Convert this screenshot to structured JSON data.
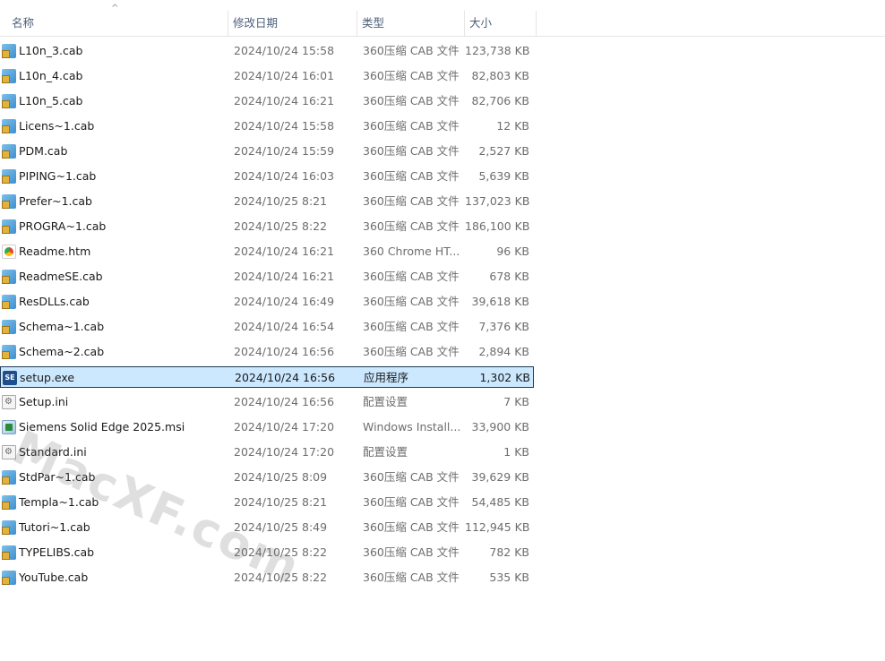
{
  "columns": {
    "name": "名称",
    "date": "修改日期",
    "type": "类型",
    "size": "大小"
  },
  "files": [
    {
      "name": "L10n_3.cab",
      "date": "2024/10/24 15:58",
      "type": "360压缩 CAB 文件",
      "size": "123,738 KB",
      "icon": "cab-archive-icon"
    },
    {
      "name": "L10n_4.cab",
      "date": "2024/10/24 16:01",
      "type": "360压缩 CAB 文件",
      "size": "82,803 KB",
      "icon": "cab-archive-icon"
    },
    {
      "name": "L10n_5.cab",
      "date": "2024/10/24 16:21",
      "type": "360压缩 CAB 文件",
      "size": "82,706 KB",
      "icon": "cab-archive-icon"
    },
    {
      "name": "Licens~1.cab",
      "date": "2024/10/24 15:58",
      "type": "360压缩 CAB 文件",
      "size": "12 KB",
      "icon": "cab-archive-icon"
    },
    {
      "name": "PDM.cab",
      "date": "2024/10/24 15:59",
      "type": "360压缩 CAB 文件",
      "size": "2,527 KB",
      "icon": "cab-archive-icon"
    },
    {
      "name": "PIPING~1.cab",
      "date": "2024/10/24 16:03",
      "type": "360压缩 CAB 文件",
      "size": "5,639 KB",
      "icon": "cab-archive-icon"
    },
    {
      "name": "Prefer~1.cab",
      "date": "2024/10/25 8:21",
      "type": "360压缩 CAB 文件",
      "size": "137,023 KB",
      "icon": "cab-archive-icon"
    },
    {
      "name": "PROGRA~1.cab",
      "date": "2024/10/25 8:22",
      "type": "360压缩 CAB 文件",
      "size": "186,100 KB",
      "icon": "cab-archive-icon"
    },
    {
      "name": "Readme.htm",
      "date": "2024/10/24 16:21",
      "type": "360 Chrome HT...",
      "size": "96 KB",
      "icon": "html-document-icon"
    },
    {
      "name": "ReadmeSE.cab",
      "date": "2024/10/24 16:21",
      "type": "360压缩 CAB 文件",
      "size": "678 KB",
      "icon": "cab-archive-icon"
    },
    {
      "name": "ResDLLs.cab",
      "date": "2024/10/24 16:49",
      "type": "360压缩 CAB 文件",
      "size": "39,618 KB",
      "icon": "cab-archive-icon"
    },
    {
      "name": "Schema~1.cab",
      "date": "2024/10/24 16:54",
      "type": "360压缩 CAB 文件",
      "size": "7,376 KB",
      "icon": "cab-archive-icon"
    },
    {
      "name": "Schema~2.cab",
      "date": "2024/10/24 16:56",
      "type": "360压缩 CAB 文件",
      "size": "2,894 KB",
      "icon": "cab-archive-icon"
    },
    {
      "name": "setup.exe",
      "date": "2024/10/24 16:56",
      "type": "应用程序",
      "size": "1,302 KB",
      "icon": "solid-edge-app-icon",
      "icon_text": "SE",
      "selected": true
    },
    {
      "name": "Setup.ini",
      "date": "2024/10/24 16:56",
      "type": "配置设置",
      "size": "7 KB",
      "icon": "settings-file-icon"
    },
    {
      "name": "Siemens Solid Edge 2025.msi",
      "date": "2024/10/24 17:20",
      "type": "Windows Install...",
      "size": "33,900 KB",
      "icon": "installer-package-icon"
    },
    {
      "name": "Standard.ini",
      "date": "2024/10/24 17:20",
      "type": "配置设置",
      "size": "1 KB",
      "icon": "settings-file-icon"
    },
    {
      "name": "StdPar~1.cab",
      "date": "2024/10/25 8:09",
      "type": "360压缩 CAB 文件",
      "size": "39,629 KB",
      "icon": "cab-archive-icon"
    },
    {
      "name": "Templa~1.cab",
      "date": "2024/10/25 8:21",
      "type": "360压缩 CAB 文件",
      "size": "54,485 KB",
      "icon": "cab-archive-icon"
    },
    {
      "name": "Tutori~1.cab",
      "date": "2024/10/25 8:49",
      "type": "360压缩 CAB 文件",
      "size": "112,945 KB",
      "icon": "cab-archive-icon"
    },
    {
      "name": "TYPELIBS.cab",
      "date": "2024/10/25 8:22",
      "type": "360压缩 CAB 文件",
      "size": "782 KB",
      "icon": "cab-archive-icon"
    },
    {
      "name": "YouTube.cab",
      "date": "2024/10/25 8:22",
      "type": "360压缩 CAB 文件",
      "size": "535 KB",
      "icon": "cab-archive-icon"
    }
  ],
  "watermark": "MacXF.com"
}
